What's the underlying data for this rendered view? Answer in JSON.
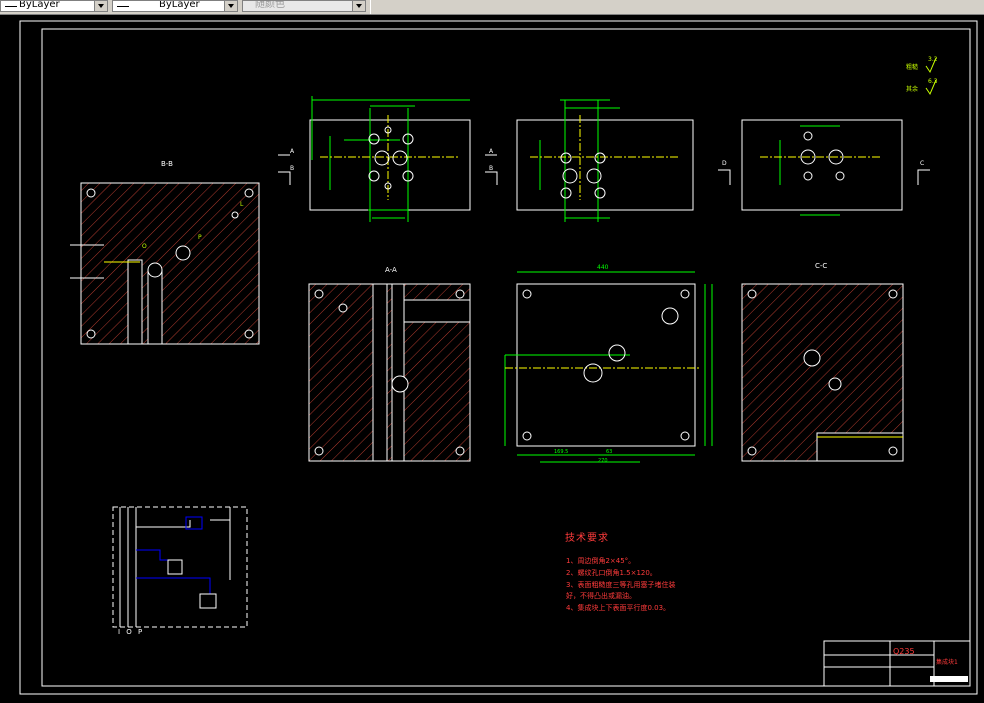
{
  "toolbar": {
    "linetype_value": "ByLayer",
    "lineweight_value": "ByLayer",
    "color_value": "随颜色"
  },
  "drawing": {
    "section_bb": "B-B",
    "section_aa": "A-A",
    "section_cc": "C-C",
    "view_markers": [
      "A",
      "B",
      "A",
      "B",
      "D",
      "C"
    ],
    "port_labels": [
      "P",
      "O",
      "L"
    ],
    "dim_top_width": "440",
    "dim_bottom_total": "270",
    "dim_bottom_a": "169.5",
    "dim_bottom_b": "63",
    "roughness_1": "粗糙",
    "roughness_2": "其余",
    "roughness_val_1": "3.2",
    "roughness_val_2": "6.3",
    "iop": "I O P"
  },
  "tech_requirements": {
    "title": "技术要求",
    "lines": [
      "1、周边倒角2×45°。",
      "2、螺纹孔口倒角1.5×120。",
      "3、表面粗糙度三等孔用塞子堵住装",
      "   好，不得凸出或漏油。",
      "4、集成块上下表面平行度0.03。"
    ]
  },
  "title_block": {
    "material": "Q235",
    "part_name": "集成块1"
  },
  "colors": {
    "toolbar_bg": "#d4d0c8",
    "drawing_bg": "#000000",
    "frame": "#ffffff",
    "hatch": "#c0392b",
    "dimension": "#00ff00",
    "centerline": "#ffff00",
    "text_red": "#ff3b3b"
  }
}
